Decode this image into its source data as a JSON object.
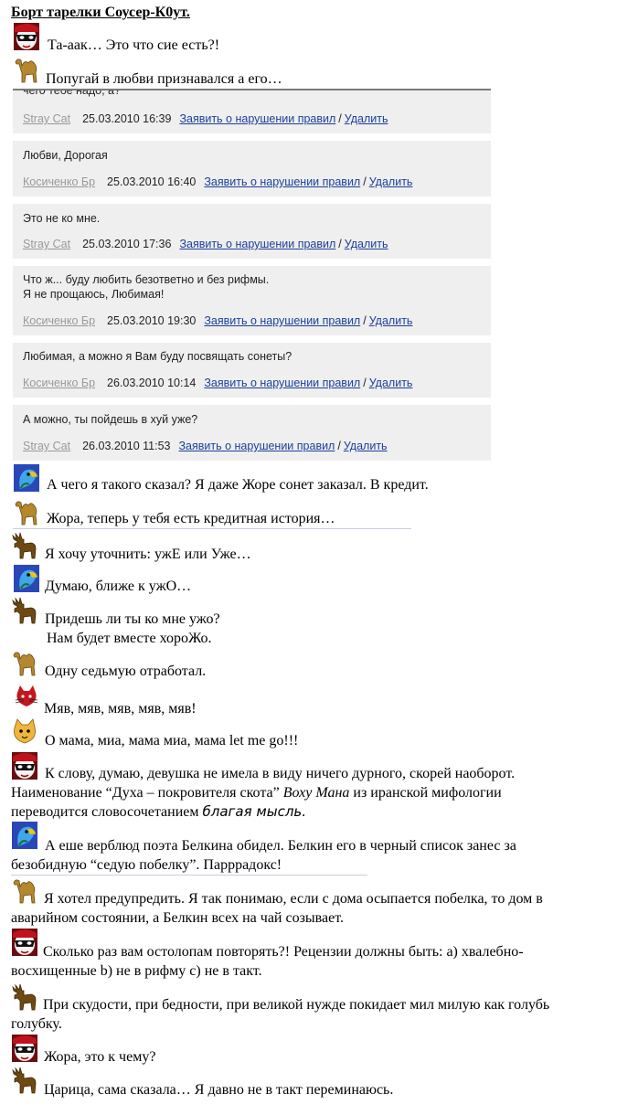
{
  "title": "Борт тарелки Соусер-К0ут.",
  "intro": [
    {
      "avatar": "harlequin",
      "text": "Та-аак… Это что сие есть?!"
    },
    {
      "avatar": "camel",
      "text": "Попугай в любви признавался а его…"
    }
  ],
  "forum": {
    "report_label": "Заявить о нарушении правил",
    "delete_label": "Удалить",
    "separator": "/",
    "posts": [
      {
        "text": "чего тебе надо, а?",
        "author": "Stray Cat",
        "date": "25.03.2010 16:39"
      },
      {
        "text": "Любви, Дорогая",
        "author": "Косиченко Бр",
        "date": "25.03.2010 16:40"
      },
      {
        "text": "Это не ко мне.",
        "author": "Stray Cat",
        "date": "25.03.2010 17:36"
      },
      {
        "text": "Что ж... буду любить безответно и без рифмы.",
        "text2": "Я не прощаюсь, Любимая!",
        "author": "Косиченко Бр",
        "date": "25.03.2010 19:30"
      },
      {
        "text": "Любимая, а можно я Вам буду посвящать сонеты?",
        "author": "Косиченко Бр",
        "date": "26.03.2010 10:14"
      },
      {
        "text": "А можно, ты пойдешь в хуй уже?",
        "author": "Stray Cat",
        "date": "26.03.2010 11:53"
      }
    ]
  },
  "dialogue": [
    {
      "avatar": "parrot",
      "text": "А чего я такого сказал? Я даже Жоре сонет заказал. В кредит."
    },
    {
      "avatar": "camel",
      "text": "Жора, теперь у тебя есть кредитная история…"
    },
    {
      "avatar": "moose",
      "text": "Я хочу уточнить: ужЕ или Уже…"
    },
    {
      "avatar": "parrot",
      "text": "Думаю, ближе к ужО…"
    },
    {
      "avatar": "moose",
      "text": "Придешь ли ты ко мне ужо?",
      "text2": "Нам будет вместе хороЖо."
    },
    {
      "avatar": "camel",
      "text": "Одну седьмую отработал."
    },
    {
      "avatar": "cat",
      "text": "Мяв, мяв, мяв, мяв, мяв!"
    },
    {
      "avatar": "cat2",
      "text": "О мама, миа, мама миа, мама let me go!!!"
    },
    {
      "avatar": "harlequin",
      "text": "К слову, думаю, девушка не имела в виду ничего дурного, скорей наоборот.  Наименование “Духа – покровителя скота” ",
      "italic": "Воху Мана",
      "text_after": "  из иранской мифологии переводится словосочетанием ",
      "italic2": "благая мысль."
    },
    {
      "avatar": "parrot",
      "text": "А еше верблюд поэта Белкина обидел. Белкин его в черный список занес за безобидную “седую побелку”. Парррадокс!"
    },
    {
      "avatar": "camel",
      "text": "Я хотел предупредить. Я так понимаю, если с дома осыпается побелка, то дом в аварийном состоянии, а Белкин всех на чай созывает."
    },
    {
      "avatar": "harlequin",
      "text": "Сколько раз вам остолопам повторять?! Рецензии должны быть: а) хвалебно-восхищенные b) не в рифму  c)  не в такт."
    },
    {
      "avatar": "moose",
      "text": "При скудости, при бедности, при великой нужде покидает мил милую как голубь голубку."
    },
    {
      "avatar": "harlequin",
      "text": "Жора, это к чему?"
    },
    {
      "avatar": "moose",
      "text": "Царица, сама сказала… Я давно не в такт переминаюсь."
    }
  ]
}
